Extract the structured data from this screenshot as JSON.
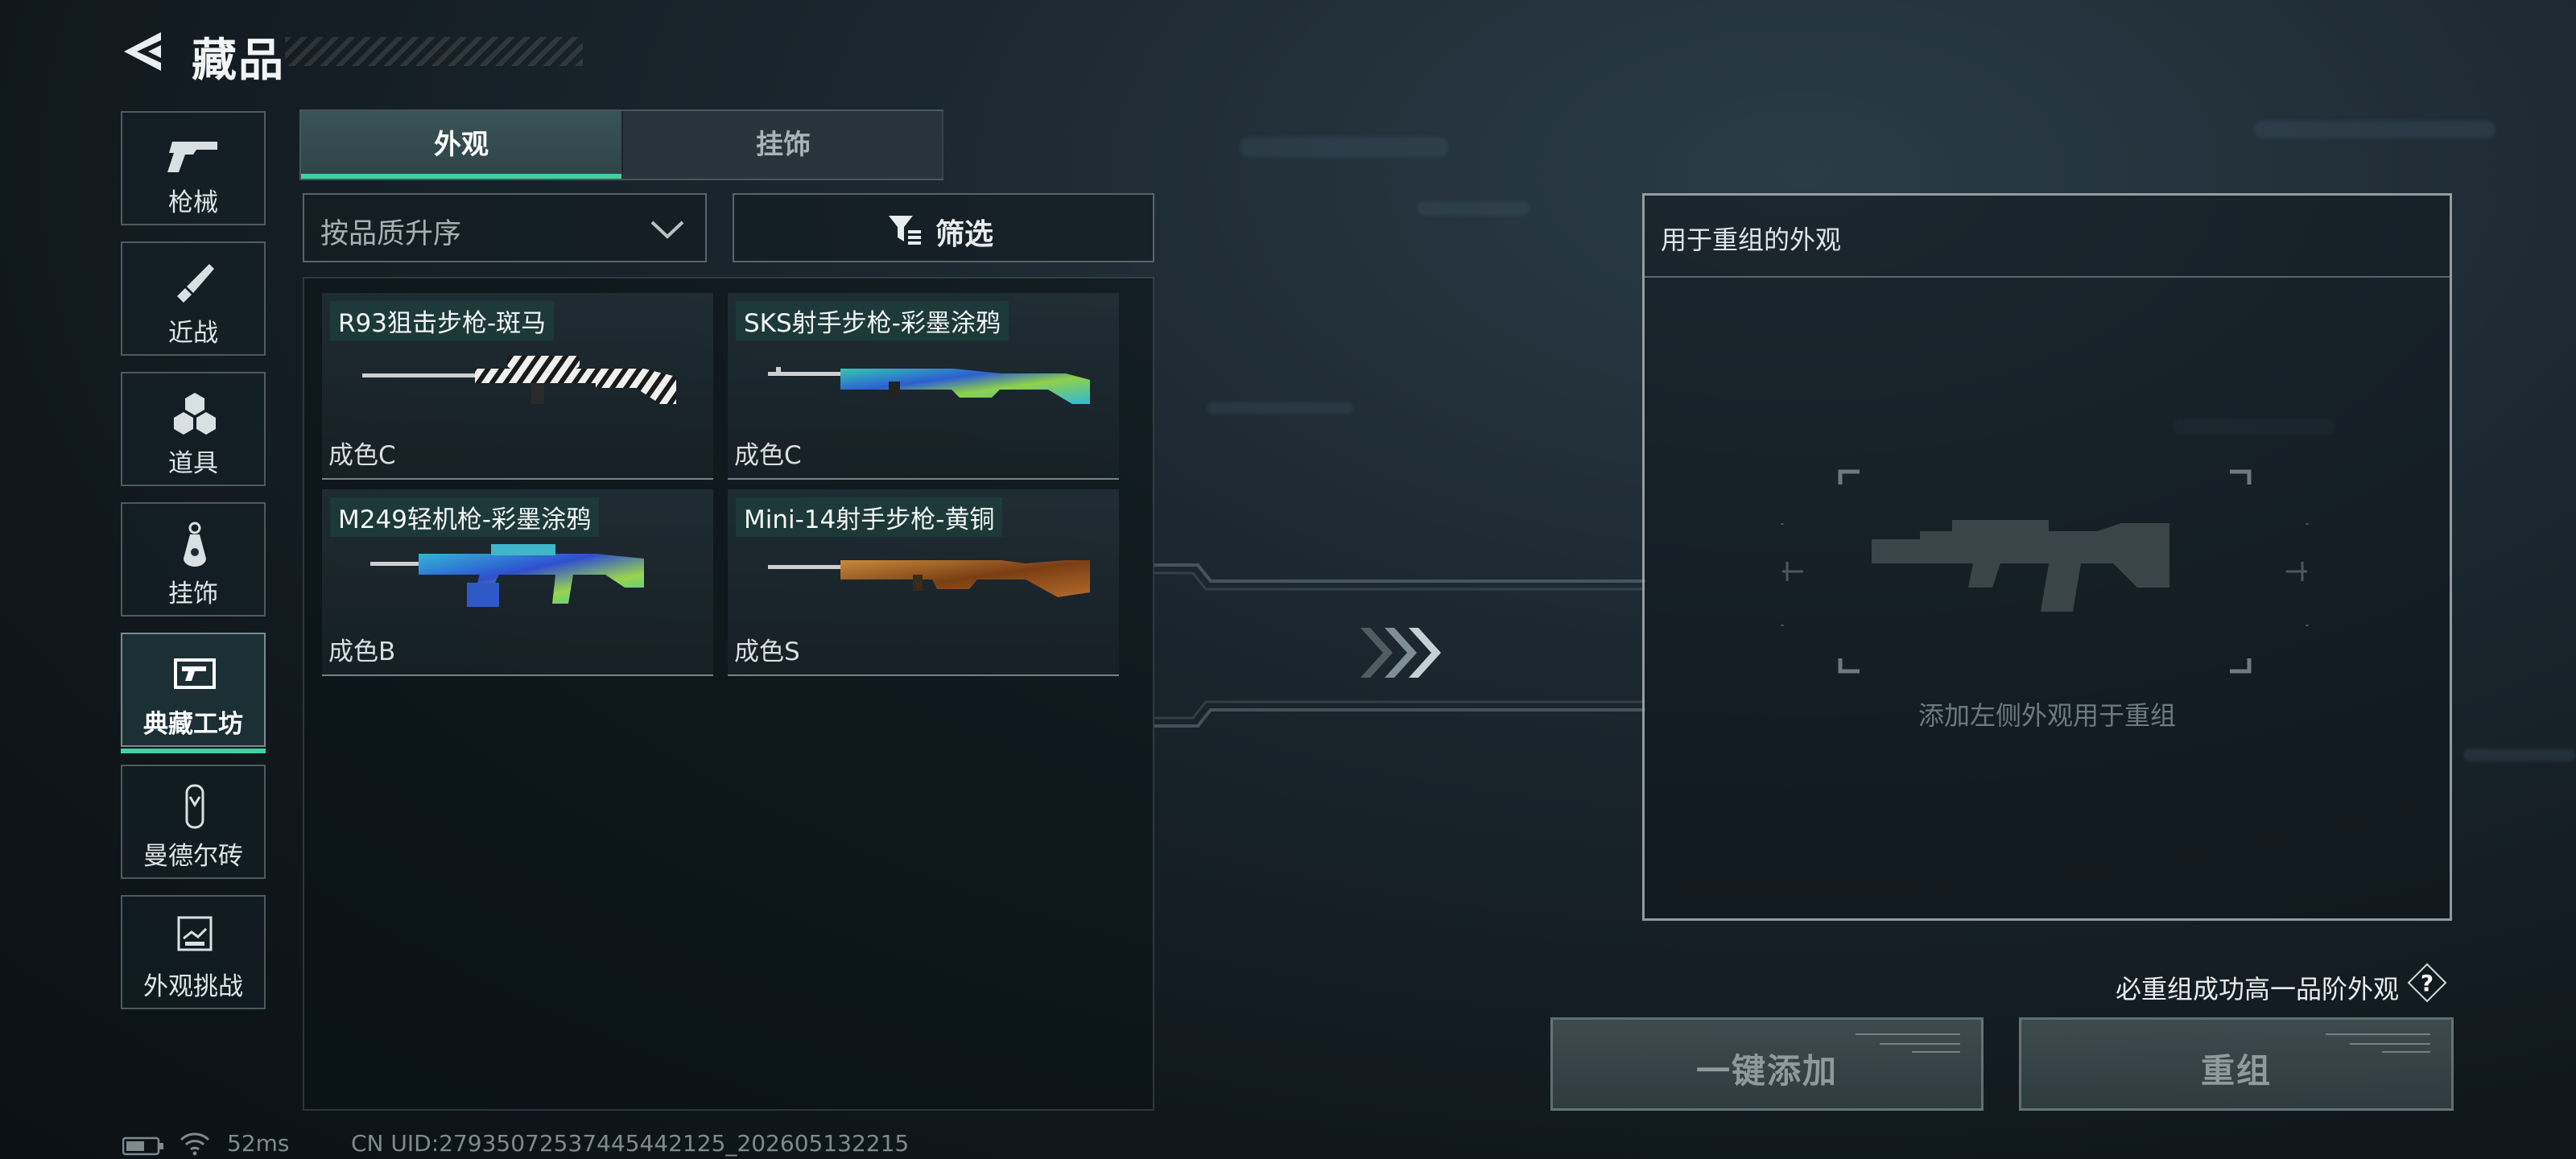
{
  "header": {
    "title": "藏品"
  },
  "nav": {
    "items": [
      {
        "label": "枪械",
        "icon": "pistol-icon"
      },
      {
        "label": "近战",
        "icon": "knife-icon"
      },
      {
        "label": "道具",
        "icon": "grenade-icon"
      },
      {
        "label": "挂饰",
        "icon": "charm-icon"
      },
      {
        "label": "典藏工坊",
        "icon": "workshop-icon",
        "active": true
      },
      {
        "label": "曼德尔砖",
        "icon": "brick-icon"
      },
      {
        "label": "外观挑战",
        "icon": "challenge-icon"
      }
    ]
  },
  "tabs": [
    {
      "label": "外观",
      "active": true
    },
    {
      "label": "挂饰",
      "active": false
    }
  ],
  "sort": {
    "label": "按品质升序"
  },
  "filter": {
    "label": "筛选"
  },
  "items": [
    {
      "name": "R93狙击步枪-斑马",
      "quality": "成色C",
      "skin": "zebra"
    },
    {
      "name": "SKS射手步枪-彩墨涂鸦",
      "quality": "成色C",
      "skin": "graffiti"
    },
    {
      "name": "M249轻机枪-彩墨涂鸦",
      "quality": "成色B",
      "skin": "graffiti"
    },
    {
      "name": "Mini-14射手步枪-黄铜",
      "quality": "成色S",
      "skin": "brass"
    }
  ],
  "recombine": {
    "title": "用于重组的外观",
    "placeholder": "添加左侧外观用于重组",
    "guarantee": "必重组成功高一品阶外观",
    "help": "?",
    "add_all_label": "一键添加",
    "recombine_label": "重组"
  },
  "status": {
    "ping": "52ms",
    "uid": "CN UID:27935072537445442125_202605132215"
  },
  "colors": {
    "accent": "#3fd2a0",
    "background": "#0f171c"
  }
}
